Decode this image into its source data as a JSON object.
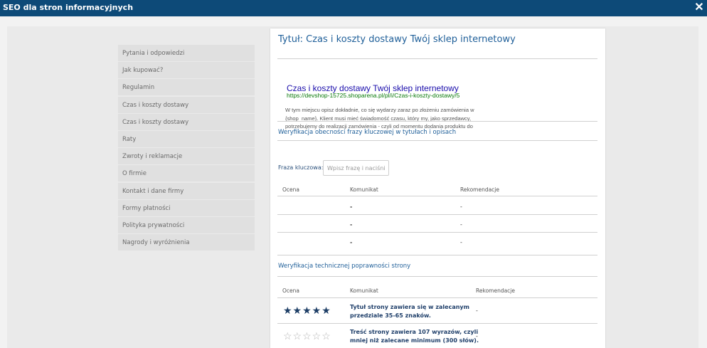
{
  "window": {
    "title": "SEO dla stron informacyjnych",
    "close_icon": "close-icon"
  },
  "sidebar": {
    "items": [
      {
        "label": "Pytania i odpowiedzi"
      },
      {
        "label": "Jak kupować?"
      },
      {
        "label": "Regulamin"
      },
      {
        "label": "Czas i koszty dostawy"
      },
      {
        "label": "Czas i koszty dostawy"
      },
      {
        "label": "Raty"
      },
      {
        "label": "Zwroty i reklamacje"
      },
      {
        "label": "O firmie"
      },
      {
        "label": "Kontakt i dane firmy"
      },
      {
        "label": "Formy płatności"
      },
      {
        "label": "Polityka prywatności"
      },
      {
        "label": "Nagrody i wyróżnienia"
      }
    ]
  },
  "main": {
    "title": "Tytuł: Czas i koszty dostawy Twój sklep internetowy",
    "preview": {
      "title": "Czas i koszty dostawy Twój sklep internetowy",
      "url": "https://devshop-15725.shoparena.pl/pl/i/Czas-i-koszty-dostawy/5",
      "description": "W tym miejscu opisz dokładnie, co się wydarzy zaraz po złożeniu zamówienia w {shop_name}. Klient musi mieć świadomość czasu, który my, jako sprzedawcy, potrzebujemy do realizacji zamówienia - czyli od momentu dodania produktu do"
    },
    "keyword_section": {
      "title": "Weryfikacja obecności frazy kluczowej w tytułach i opisach",
      "keyword_label": "Fraza kluczowa:",
      "keyword_placeholder": "Wpisz frazę i naciśnij E",
      "headers": {
        "rating": "Ocena",
        "message": "Komunikat",
        "recommendations": "Rekomendacje"
      },
      "rows": [
        {
          "rating": "",
          "message": "-",
          "recommendation": "-"
        },
        {
          "rating": "",
          "message": "-",
          "recommendation": "-"
        },
        {
          "rating": "",
          "message": "-",
          "recommendation": "-"
        }
      ]
    },
    "technical_section": {
      "title": "Weryfikacja technicznej poprawności strony",
      "headers": {
        "rating": "Ocena",
        "message": "Komunikat",
        "recommendations": "Rekomendacje"
      },
      "rows": [
        {
          "stars": 5,
          "stars_glyphs": "★★★★★",
          "message": "Tytuł strony zawiera się w zalecanym przedziale 35-65 znaków.",
          "recommendation": "-"
        },
        {
          "stars": 0,
          "stars_glyphs": "☆☆☆☆☆",
          "message": "Treść strony zawiera 107 wyrazów, czyli mniej niż zalecane minimum (300 słów).",
          "recommendation": "-"
        }
      ]
    }
  },
  "colors": {
    "titlebar": "#0d4a78",
    "accent_text": "#1f5f99",
    "link": "#1a0dab",
    "url": "#0a7a0a",
    "star_filled": "#1d3e66",
    "star_empty": "#b5b5b5"
  }
}
